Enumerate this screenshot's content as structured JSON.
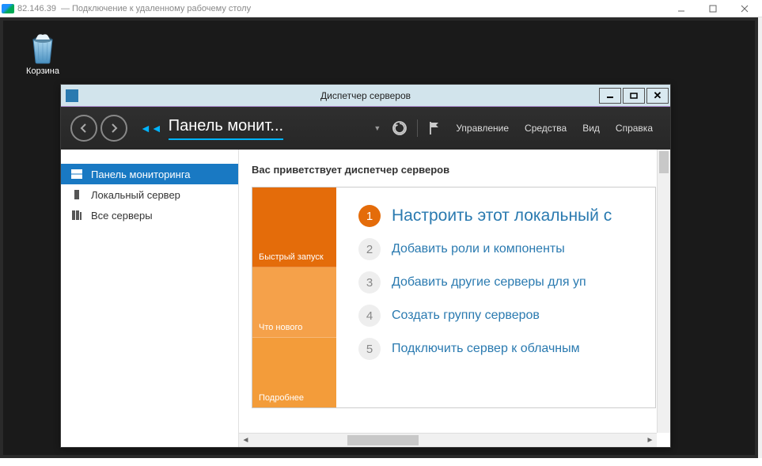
{
  "rdp": {
    "ip": "82.146.39",
    "title": "— Подключение к удаленному рабочему столу"
  },
  "desktop": {
    "recycle_bin": "Корзина"
  },
  "server_manager": {
    "title": "Диспетчер серверов",
    "breadcrumb": "Панель монит...",
    "menus": {
      "manage": "Управление",
      "tools": "Средства",
      "view": "Вид",
      "help": "Справка"
    },
    "sidebar": {
      "dashboard": "Панель мониторинга",
      "local_server": "Локальный сервер",
      "all_servers": "Все серверы"
    },
    "welcome": "Вас приветствует диспетчер серверов",
    "tiles": {
      "quick_start": "Быстрый запуск",
      "whats_new": "Что нового",
      "learn_more": "Подробнее"
    },
    "steps": {
      "s1": {
        "num": "1",
        "text": "Настроить этот локальный с"
      },
      "s2": {
        "num": "2",
        "text": "Добавить роли и компоненты"
      },
      "s3": {
        "num": "3",
        "text": "Добавить другие серверы для уп"
      },
      "s4": {
        "num": "4",
        "text": "Создать группу серверов"
      },
      "s5": {
        "num": "5",
        "text": "Подключить сервер к облачным"
      }
    }
  }
}
